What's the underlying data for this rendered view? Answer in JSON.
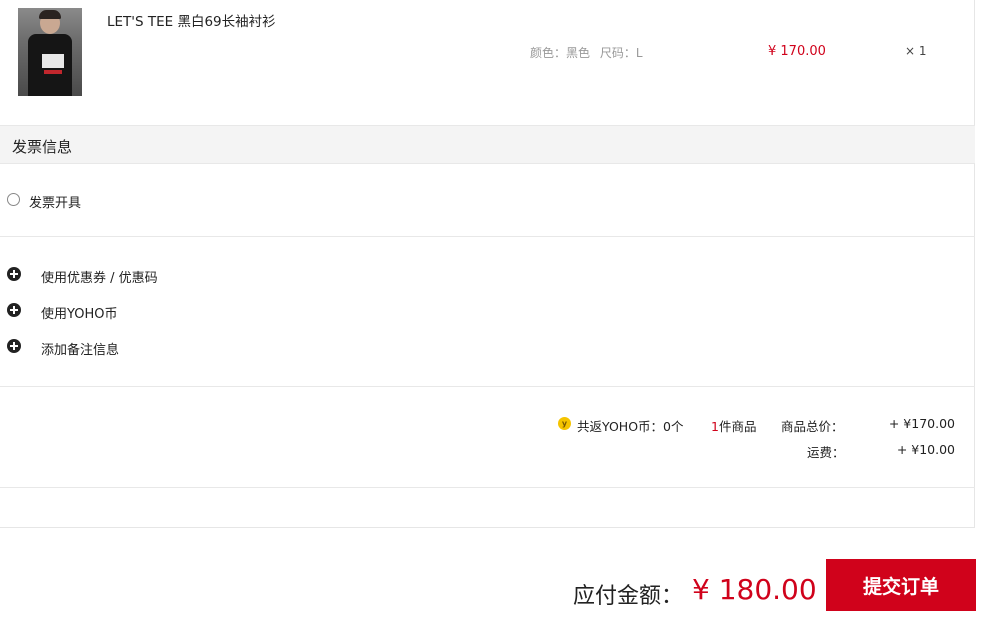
{
  "product": {
    "name": "LET'S TEE 黑白69长袖衬衫",
    "color_label": "颜色：黑色",
    "size_label": "尺码：L",
    "price": "¥ 170.00",
    "quantity": "× 1"
  },
  "invoice": {
    "section_title": "发票信息",
    "issue_label": "发票开具"
  },
  "options": [
    {
      "label": "使用优惠券 / 优惠码"
    },
    {
      "label": "使用YOHO币"
    },
    {
      "label": "添加备注信息"
    }
  ],
  "summary": {
    "coin_icon": "y",
    "coin_text": "共返YOHO币：0个",
    "item_count": "1",
    "item_count_suffix": "件商品",
    "goods_total_label": "商品总价：",
    "goods_total_value": "+ ¥170.00",
    "shipping_label": "运费：",
    "shipping_value": "+ ¥10.00"
  },
  "footer": {
    "amount_label": "应付金额：",
    "amount_value": "¥ 180.00",
    "submit_label": "提交订单"
  },
  "colors": {
    "accent": "#d0021b",
    "header_bg": "#f4f4f4"
  }
}
